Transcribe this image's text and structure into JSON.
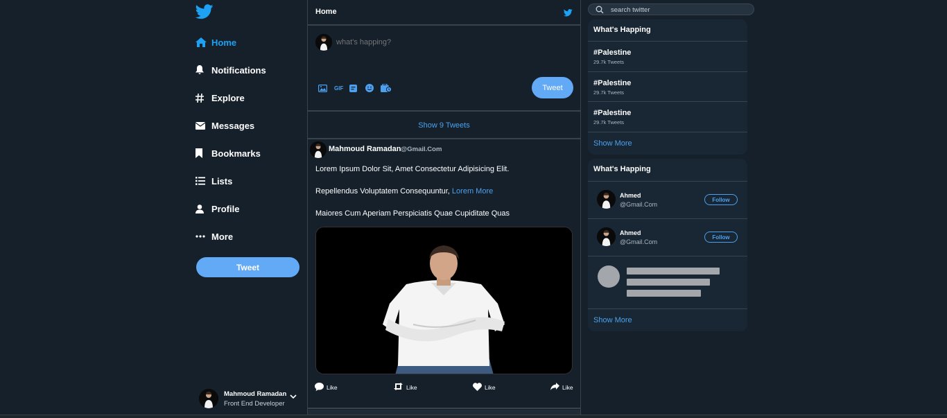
{
  "colors": {
    "background": "#15202b",
    "accent": "#1da1f2",
    "button": "#62a9f6",
    "card": "#192734"
  },
  "sidebar": {
    "logo_icon": "twitter-bird-icon",
    "items": [
      {
        "label": "Home",
        "icon": "home-icon",
        "active": true
      },
      {
        "label": "Notifications",
        "icon": "bell-icon"
      },
      {
        "label": "Explore",
        "icon": "hashtag-icon"
      },
      {
        "label": "Messages",
        "icon": "envelope-icon"
      },
      {
        "label": "Bookmarks",
        "icon": "bookmark-icon"
      },
      {
        "label": "Lists",
        "icon": "list-icon"
      },
      {
        "label": "Profile",
        "icon": "user-icon"
      },
      {
        "label": "More",
        "icon": "ellipsis-icon"
      }
    ],
    "tweet_button": "Tweet",
    "user": {
      "name": "Mahmoud Ramadan",
      "title": "Front End Developer"
    }
  },
  "feed": {
    "header_title": "Home",
    "compose": {
      "placeholder": "what's happing?",
      "tool_icons": [
        "image-icon",
        "gif-icon",
        "poll-icon",
        "emoji-icon",
        "schedule-icon"
      ],
      "tweet_button": "Tweet"
    },
    "show_tweets": "Show 9 Tweets",
    "post": {
      "author": "Mahmoud Ramadan",
      "handle": "@Gmail.Com",
      "line1": "Lorem Ipsum Dolor Sit, Amet Consectetur Adipisicing Elit.",
      "line2": "Repellendus Voluptatem Consequuntur,",
      "line2_link": "Lorem More",
      "line3": "Maiores Cum Aperiam Perspiciatis Quae Cupiditate Quas",
      "actions": [
        {
          "label": "Like",
          "icon": "comment-icon"
        },
        {
          "label": "Like",
          "icon": "retweet-icon"
        },
        {
          "label": "Like",
          "icon": "heart-icon"
        },
        {
          "label": "Like",
          "icon": "share-icon"
        }
      ]
    }
  },
  "right": {
    "search_placeholder": "search twitter",
    "trends": {
      "title": "What's Happing",
      "items": [
        {
          "tag": "#Palestine",
          "count": "29.7k Tweets"
        },
        {
          "tag": "#Palestine",
          "count": "29.7k Tweets"
        },
        {
          "tag": "#Palestine",
          "count": "29.7k Tweets"
        }
      ],
      "show_more": "Show More"
    },
    "who": {
      "title": "What's Happing",
      "users": [
        {
          "name": "Ahmed",
          "handle": "@Gmail.Com",
          "follow": "Follow"
        },
        {
          "name": "Ahmed",
          "handle": "@Gmail.Com",
          "follow": "Follow"
        }
      ],
      "show_more": "Show More"
    }
  }
}
